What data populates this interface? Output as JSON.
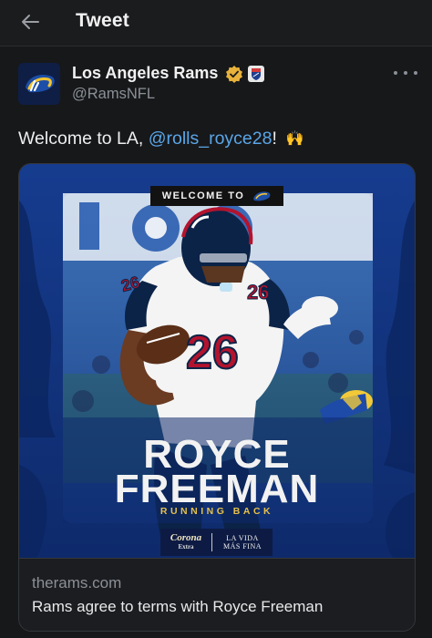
{
  "header": {
    "title": "Tweet",
    "back_icon": "arrow-left-icon"
  },
  "tweet": {
    "author": {
      "name": "Los Angeles Rams",
      "handle": "@RamsNFL",
      "verified": true,
      "verified_color": "#e8b23b"
    },
    "text_prefix": "Welcome to LA, ",
    "mention": "@rolls_royce28",
    "text_suffix": "!",
    "emoji": "🙌",
    "mention_color": "#5aa6e8",
    "card": {
      "domain": "therams.com",
      "title": "Rams agree to terms with Royce Freeman",
      "image": {
        "badge": "WELCOME TO",
        "jersey_number": "26",
        "headline_line1": "ROYCE",
        "headline_line2": "FREEMAN",
        "position": "RUNNING BACK",
        "sponsor_brand": "Corona",
        "sponsor_sub": "Extra",
        "sponsor_tagline_1": "LA VIDA",
        "sponsor_tagline_2": "MÁS FINA",
        "colors": {
          "background": "#12327a",
          "accent_gold": "#e5c04a",
          "jersey": "#f4f4f4",
          "helmet": "#0b2347",
          "number_red": "#b3132e"
        }
      }
    }
  }
}
